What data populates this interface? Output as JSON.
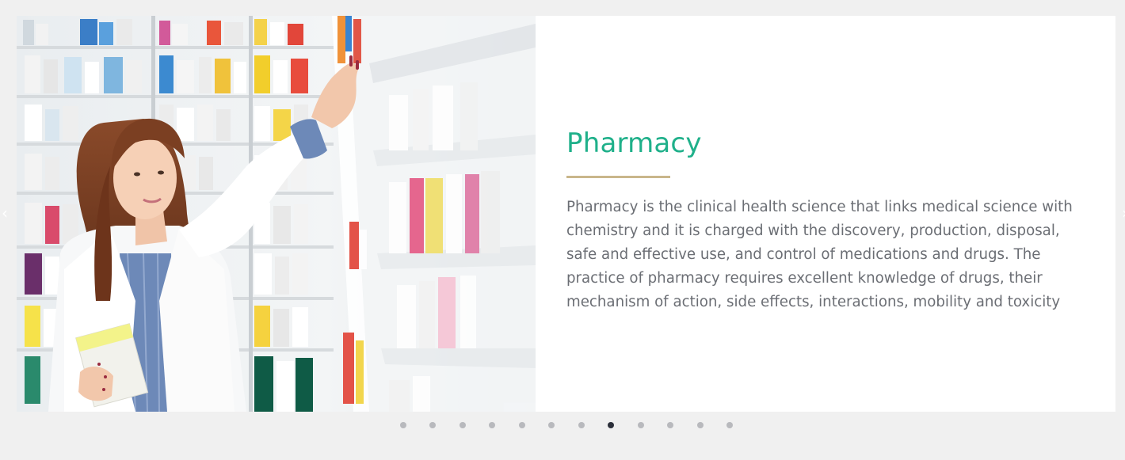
{
  "slide": {
    "title": "Pharmacy",
    "body": "Pharmacy is the clinical health science that links medical science with chemistry and it is charged with the discovery, production, disposal, safe and effective use, and control of medications and drugs. The practice of pharmacy requires excellent knowledge of drugs, their mechanism of action, side effects, interactions, mobility and toxicity",
    "image_subject": "pharmacist reaching for medicine on pharmacy shelves"
  },
  "carousel": {
    "dot_count": 12,
    "active_index": 7,
    "prev_icon": "chevron-left-icon",
    "next_icon": "chevron-right-icon"
  },
  "colors": {
    "title": "#1fb08a",
    "underline": "#c9b68b",
    "body_text": "#6b6e74",
    "page_background": "#f0f0f0",
    "dot_inactive": "#b8b9bd",
    "dot_active": "#2b2f3a"
  }
}
